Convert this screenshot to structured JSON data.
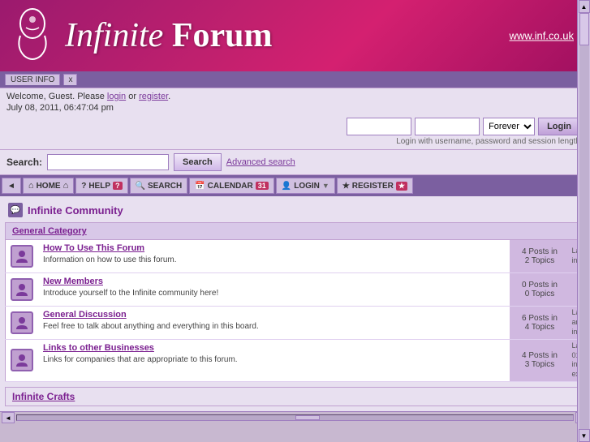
{
  "header": {
    "title_italic": "Infinite",
    "title_bold": "Forum",
    "url": "www.inf.co.uk",
    "logo_alt": "Infinite Forum Logo"
  },
  "user_info": {
    "tab_label": "USER INFO",
    "tab_close": "x",
    "welcome_text": "Welcome, Guest. Please",
    "login_link": "login",
    "or_text": "or",
    "register_link": "register",
    "date_text": "July 08, 2011, 06:47:04 pm",
    "username_placeholder": "",
    "password_placeholder": "",
    "forever_label": "Forever",
    "login_button": "Login",
    "login_hint": "Login with username, password and session length"
  },
  "search": {
    "label": "Search:",
    "placeholder": "",
    "button_label": "Search",
    "advanced_link": "Advanced search"
  },
  "nav": {
    "items": [
      {
        "icon": "◄",
        "label": ""
      },
      {
        "icon": "🏠",
        "label": "HOME",
        "has_home_icon": true
      },
      {
        "icon": "?",
        "label": "HELP",
        "badge": "?"
      },
      {
        "icon": "🔍",
        "label": "SEARCH"
      },
      {
        "icon": "📅",
        "label": "CALENDAR",
        "badge": "31"
      },
      {
        "icon": "👤",
        "label": "LOGIN",
        "has_arrow": true
      },
      {
        "icon": "★",
        "label": "REGISTER",
        "badge": "★"
      }
    ]
  },
  "community": {
    "icon": "💬",
    "title": "Infinite Community",
    "categories": [
      {
        "name": "General Category",
        "forums": [
          {
            "name": "How To Use This Forum",
            "description": "Information on how to use this forum.",
            "posts": "4 Posts in",
            "topics": "2 Topics",
            "last_post_line1": "La",
            "last_post_line2": "in"
          },
          {
            "name": "New Members",
            "description": "Introduce yourself to the Infinite community here!",
            "posts": "0 Posts in",
            "topics": "0 Topics",
            "last_post_line1": "",
            "last_post_line2": ""
          },
          {
            "name": "General Discussion",
            "description": "Feel free to talk about anything and everything in this board.",
            "posts": "6 Posts in",
            "topics": "4 Topics",
            "last_post_line1": "La",
            "last_post_line2": "an",
            "last_post_line3": "in"
          },
          {
            "name": "Links to other Businesses",
            "description": "Links for companies that are appropriate to this forum.",
            "posts": "4 Posts in",
            "topics": "3 Topics",
            "last_post_line1": "La",
            "last_post_line2": "01",
            "last_post_line3": "in",
            "last_post_line4": "ex"
          }
        ]
      }
    ]
  },
  "bottom": {
    "title": "Infinite Crafts"
  },
  "scrollbar": {
    "left_arrow": "◄",
    "right_arrow": "►",
    "up_arrow": "▲",
    "down_arrow": "▼"
  }
}
